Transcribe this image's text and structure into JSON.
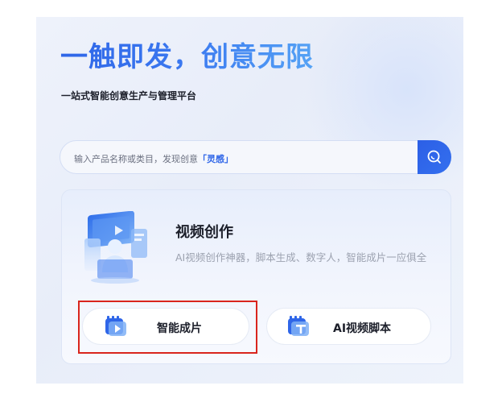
{
  "hero": {
    "title": "一触即发，创意无限",
    "subtitle": "一站式智能创意生产与管理平台"
  },
  "search": {
    "placeholder_prefix": "输入产品名称或类目，发现创意",
    "placeholder_highlight": "「灵感」",
    "button_icon": "search-icon"
  },
  "card": {
    "illustration_icon": "video-creation-illustration",
    "title": "视频创作",
    "description": "AI视频创作神器，脚本生成、数字人，智能成片一应俱全",
    "actions": [
      {
        "label": "智能成片",
        "icon": "video-play-icon"
      },
      {
        "label": "AI视频脚本",
        "icon": "script-text-icon"
      }
    ]
  },
  "colors": {
    "accent": "#2f66e8",
    "highlight_box": "#d9251d"
  }
}
